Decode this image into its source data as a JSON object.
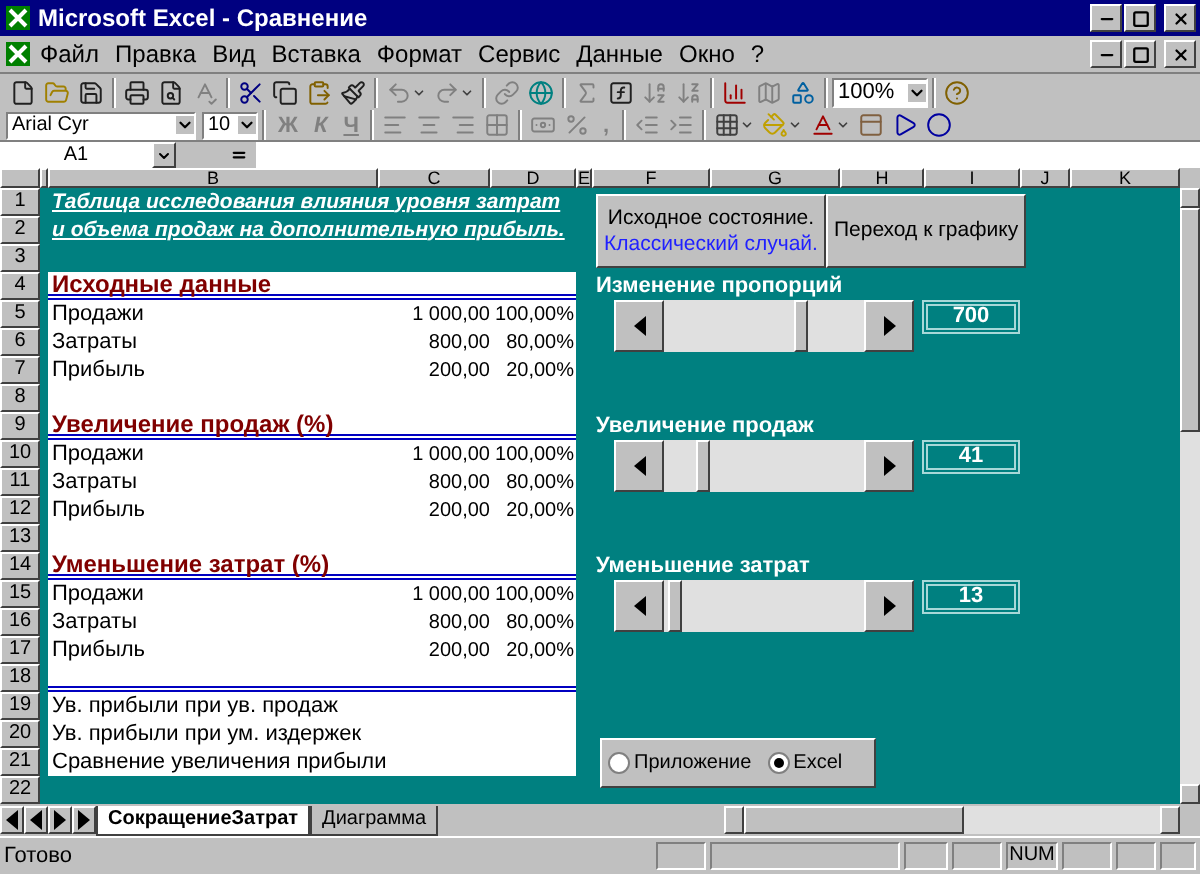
{
  "window": {
    "title": "Microsoft Excel - Сравнение"
  },
  "menu": [
    "Файл",
    "Правка",
    "Вид",
    "Вставка",
    "Формат",
    "Сервис",
    "Данные",
    "Окно",
    "?"
  ],
  "standard_toolbar": {
    "zoom": "100%"
  },
  "formatting_toolbar": {
    "font": "Arial Cyr",
    "size": "10",
    "bold": "Ж",
    "italic": "К",
    "underline": "Ч",
    "comma": ","
  },
  "formula_bar": {
    "name_box": "A1"
  },
  "columns": [
    "B",
    "C",
    "D",
    "E",
    "F",
    "G",
    "H",
    "I",
    "J",
    "K"
  ],
  "rows": [
    {
      "number": "1",
      "kind": "title",
      "text": "Таблица исследования влияния уровня затрат"
    },
    {
      "number": "2",
      "kind": "title",
      "text": "и объема продаж на дополнительную прибыль."
    },
    {
      "number": "3",
      "kind": "blank"
    },
    {
      "number": "4",
      "kind": "header",
      "text": "Исходные данные"
    },
    {
      "number": "5",
      "kind": "data",
      "label": "Продажи",
      "value": "1 000,00",
      "percent": "100,00%"
    },
    {
      "number": "6",
      "kind": "data",
      "label": "Затраты",
      "value": "800,00",
      "percent": "80,00%"
    },
    {
      "number": "7",
      "kind": "data",
      "label": "Прибыль",
      "value": "200,00",
      "percent": "20,00%"
    },
    {
      "number": "8",
      "kind": "white"
    },
    {
      "number": "9",
      "kind": "header",
      "text": "Увеличение продаж (%)"
    },
    {
      "number": "10",
      "kind": "data",
      "label": "Продажи",
      "value": "1 000,00",
      "percent": "100,00%"
    },
    {
      "number": "11",
      "kind": "data",
      "label": "Затраты",
      "value": "800,00",
      "percent": "80,00%"
    },
    {
      "number": "12",
      "kind": "data",
      "label": "Прибыль",
      "value": "200,00",
      "percent": "20,00%"
    },
    {
      "number": "13",
      "kind": "white"
    },
    {
      "number": "14",
      "kind": "header",
      "text": "Уменьшение затрат (%)"
    },
    {
      "number": "15",
      "kind": "data",
      "label": "Продажи",
      "value": "1 000,00",
      "percent": "100,00%"
    },
    {
      "number": "16",
      "kind": "data",
      "label": "Затраты",
      "value": "800,00",
      "percent": "80,00%"
    },
    {
      "number": "17",
      "kind": "data",
      "label": "Прибыль",
      "value": "200,00",
      "percent": "20,00%"
    },
    {
      "number": "18",
      "kind": "rule"
    },
    {
      "number": "19",
      "kind": "note",
      "text": "Ув. прибыли при ув. продаж"
    },
    {
      "number": "20",
      "kind": "note",
      "text": "Ув. прибыли при ум. издержек"
    },
    {
      "number": "21",
      "kind": "note",
      "text": "Сравнение увеличения прибыли"
    },
    {
      "number": "22",
      "kind": "blank"
    }
  ],
  "buttons": [
    {
      "text": "Исходное состояние.",
      "subtext": "Классический случай."
    },
    {
      "text": "Переход к графику"
    }
  ],
  "sliders": [
    {
      "label": "Изменение пропорций",
      "level": 0.7,
      "value": "700"
    },
    {
      "label": "Увеличение продаж",
      "level": 0.17,
      "value": "41"
    },
    {
      "label": "Уменьшение затрат",
      "level": 0.02,
      "value": "13"
    }
  ],
  "radio": [
    {
      "label": "Приложение",
      "selected": false
    },
    {
      "label": "Excel",
      "selected": true
    }
  ],
  "sheets": [
    {
      "label": "СокращениеЗатрат",
      "selected": true
    },
    {
      "label": "Диаграмма",
      "selected": false
    }
  ],
  "status_bar": {
    "text": "Готово",
    "num": "NUM"
  }
}
